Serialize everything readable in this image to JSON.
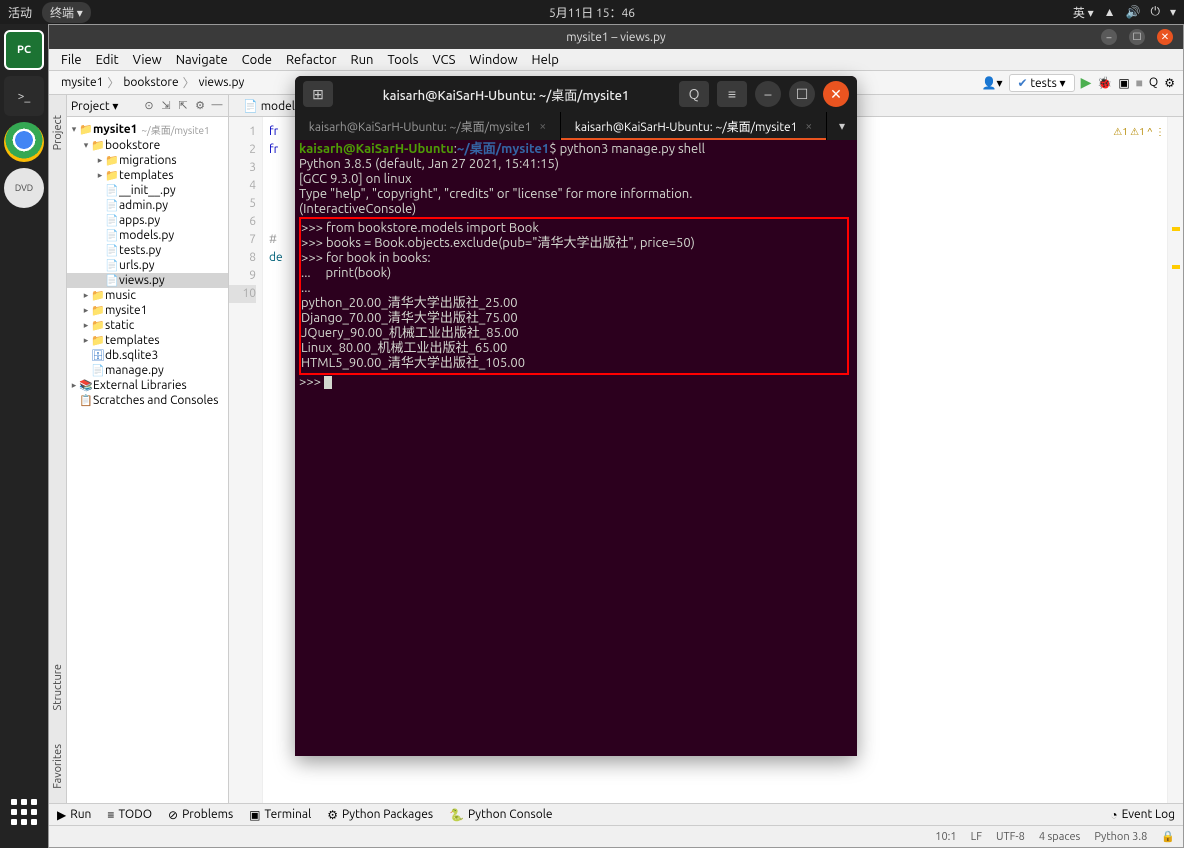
{
  "gnome": {
    "activities": "活动",
    "app": "终端 ▾",
    "clock": "5月11日 15：46",
    "ime": "英 ▾"
  },
  "ide": {
    "title": "mysite1 – views.py",
    "menus": [
      "File",
      "Edit",
      "View",
      "Navigate",
      "Code",
      "Refactor",
      "Run",
      "Tools",
      "VCS",
      "Window",
      "Help"
    ],
    "breadcrumb": [
      "mysite1",
      "bookstore",
      "views.py"
    ],
    "run_config": "tests ▾",
    "user_icon": "👤▾",
    "warn_summary": "⚠1 ⚠1 ^ ⋮",
    "project_header": "Project ▾",
    "editor_tab": "models.",
    "code_lines": [
      "fr",
      "fr",
      "",
      "",
      "",
      "",
      "#",
      "de",
      ""
    ],
    "gutter_nums": [
      "1",
      "2",
      "3",
      "4",
      "5",
      "6",
      "7",
      "8",
      "9",
      "10"
    ],
    "bottom": {
      "run": "Run",
      "todo": "TODO",
      "problems": "Problems",
      "terminal": "Terminal",
      "pypkg": "Python Packages",
      "pycon": "Python Console",
      "eventlog": "Event Log"
    },
    "status": {
      "pos": "10:1",
      "le": "LF",
      "enc": "UTF-8",
      "indent": "4 spaces",
      "interp": "Python 3.8"
    },
    "tree": {
      "root": "mysite1",
      "root_path": "~/桌面/mysite1",
      "bookstore": "bookstore",
      "migrations": "migrations",
      "templates_dir": "templates",
      "init": "__init__.py",
      "admin": "admin.py",
      "apps": "apps.py",
      "models": "models.py",
      "tests": "tests.py",
      "urls": "urls.py",
      "views": "views.py",
      "music": "music",
      "mysite1": "mysite1",
      "static": "static",
      "templates2": "templates",
      "db": "db.sqlite3",
      "manage": "manage.py",
      "ext": "External Libraries",
      "scratches": "Scratches and Consoles"
    },
    "left_tabs": {
      "project": "Project",
      "structure": "Structure",
      "favorites": "Favorites"
    }
  },
  "terminal": {
    "title": "kaisarh@KaiSarH-Ubuntu: ~/桌面/mysite1",
    "tab1": "kaisarh@KaiSarH-Ubuntu: ~/桌面/mysite1",
    "tab2": "kaisarh@KaiSarH-Ubuntu: ~/桌面/mysite1",
    "prompt_user": "kaisarh@KaiSarH-Ubuntu",
    "prompt_sep": ":",
    "prompt_path": "~/桌面/mysite1",
    "prompt_end": "$",
    "cmd": "python3 manage.py shell",
    "banner1": "Python 3.8.5 (default, Jan 27 2021, 15:41:15)",
    "banner2": "[GCC 9.3.0] on linux",
    "banner3": "Type \"help\", \"copyright\", \"credits\" or \"license\" for more information.",
    "banner4": "(InteractiveConsole)",
    "sh1": ">>> from bookstore.models import Book",
    "sh2": ">>> books = Book.objects.exclude(pub=\"清华大学出版社\", price=50)",
    "sh3": ">>> for book in books:",
    "sh4": "...     print(book)",
    "sh5": "...",
    "r1": "python_20.00_清华大学出版社_25.00",
    "r2": "Django_70.00_清华大学出版社_75.00",
    "r3": "JQuery_90.00_机械工业出版社_85.00",
    "r4": "Linux_80.00_机械工业出版社_65.00",
    "r5": "HTML5_90.00_清华大学出版社_105.00",
    "final_prompt": ">>> "
  }
}
